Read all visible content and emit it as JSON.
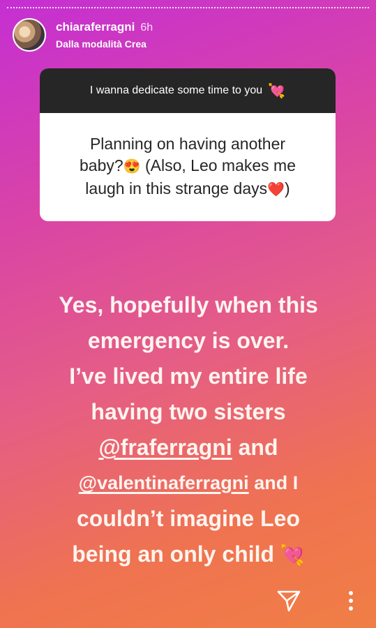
{
  "header": {
    "username": "chiaraferragni",
    "time": "6h",
    "subtitle": "Dalla modalità Crea"
  },
  "question": {
    "prompt": "I wanna dedicate some time to you",
    "prompt_emoji": "💘",
    "text_line1": "Planning on having another",
    "text_line2": "baby?",
    "emoji1": "😍",
    "text_line2b": " (Also, Leo makes me",
    "text_line3": "laugh in this strange days",
    "emoji2": "❤️",
    "text_line3b": ")"
  },
  "answer": {
    "line1": "Yes, hopefully when this",
    "line2": "emergency is over.",
    "line3": "I’ve lived my entire life",
    "line4": "having two sisters",
    "mention1": "@fraferragni",
    "line5b": " and",
    "mention2": "@valentinaferragni",
    "line6b": " and I",
    "line7": "couldn’t imagine Leo",
    "line8": "being an only child",
    "end_emoji": "💘"
  },
  "icons": [
    "send-icon",
    "more-options-icon"
  ]
}
